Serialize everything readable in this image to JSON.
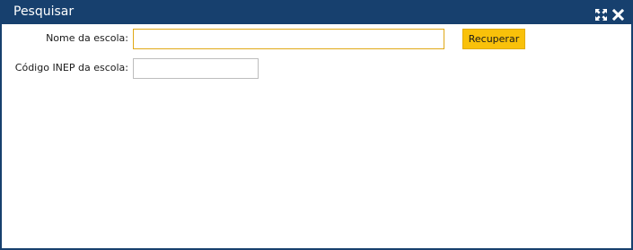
{
  "window": {
    "title": "Pesquisar",
    "controls": {
      "maximize_icon": "expand-icon",
      "close_icon": "close-icon"
    },
    "colors": {
      "titlebar": "#17406e",
      "accent_button": "#f9c10a",
      "focused_input_border": "#e0a816"
    }
  },
  "form": {
    "nome_label": "Nome da escola:",
    "nome_value": "",
    "inep_label": "Código INEP da escola:",
    "inep_value": "",
    "recuperar_label": "Recuperar"
  }
}
